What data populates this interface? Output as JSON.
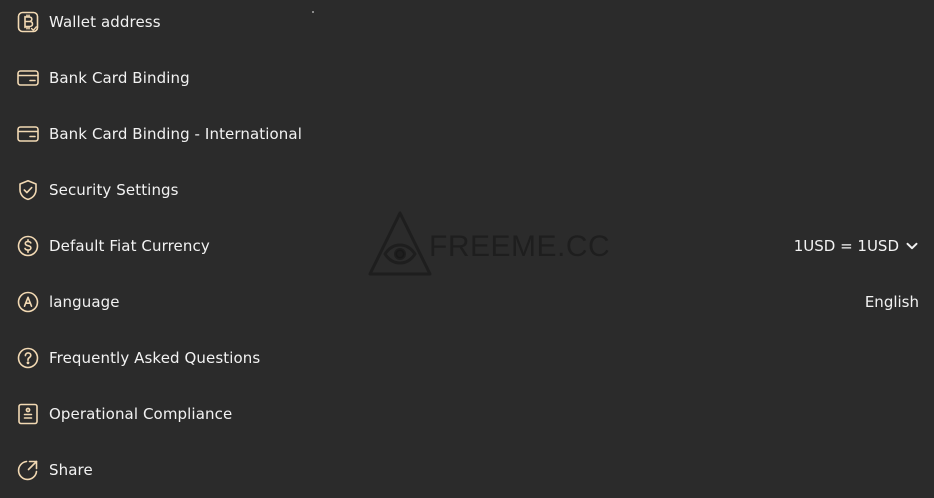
{
  "menu": {
    "items": [
      {
        "icon": "bitcoin-wallet-icon",
        "label": "Wallet address"
      },
      {
        "icon": "bank-card-icon",
        "label": "Bank Card Binding"
      },
      {
        "icon": "bank-card-icon",
        "label": "Bank Card Binding - International"
      },
      {
        "icon": "shield-check-icon",
        "label": "Security Settings"
      },
      {
        "icon": "dollar-circle-icon",
        "label": "Default Fiat Currency",
        "value": "1USD = 1USD"
      },
      {
        "icon": "language-a-icon",
        "label": "language",
        "value": "English"
      },
      {
        "icon": "question-circle-icon",
        "label": "Frequently Asked Questions"
      },
      {
        "icon": "compliance-document-icon",
        "label": "Operational Compliance"
      },
      {
        "icon": "share-icon",
        "label": "Share"
      }
    ]
  },
  "watermark": {
    "text": "FREEME.CC"
  },
  "colors": {
    "background": "#2b2b2b",
    "icon_accent": "#f2d9b3",
    "text": "#f2f2f2"
  }
}
